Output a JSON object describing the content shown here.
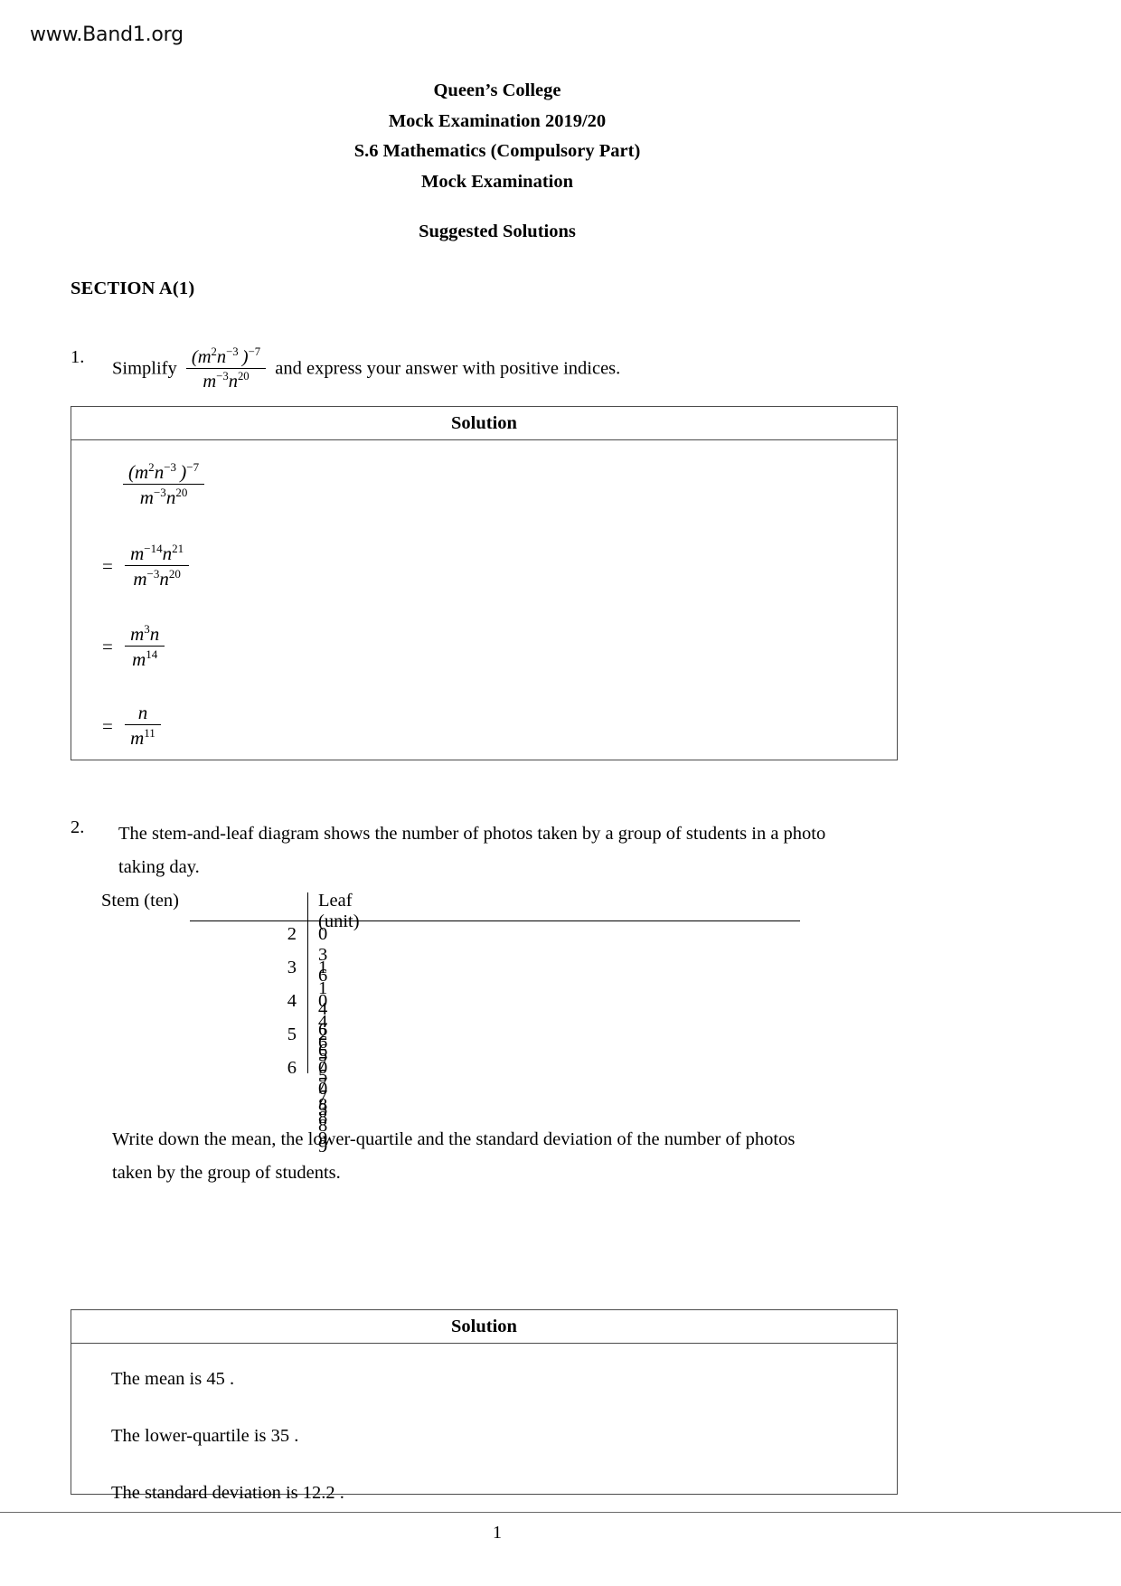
{
  "watermark": "www.Band1.org",
  "header": {
    "line1": "Queen’s College",
    "line2": "Mock Examination 2019/20",
    "line3": "S.6 Mathematics (Compulsory Part)",
    "line4": "Mock Examination",
    "line5": "Suggested Solutions"
  },
  "section": {
    "heading": "SECTION A(1)"
  },
  "solution_label": "Solution",
  "questions": [
    {
      "number": "1.",
      "text_before": "Simplify",
      "text_after": "and express your answer with positive indices.",
      "expression": {
        "numerator_base": "(m",
        "numerator": "(m²n⁻³)⁻⁷",
        "denominator": "m⁻³n²⁰"
      },
      "solution_steps": [
        {
          "eq": "",
          "num": "(m²n⁻³)⁻⁷",
          "den": "m⁻³n²⁰"
        },
        {
          "eq": "=",
          "num": "m⁻¹⁴n²¹",
          "den": "m⁻³n²⁰"
        },
        {
          "eq": "=",
          "num": "m³n",
          "den": "m¹⁴"
        },
        {
          "eq": "=",
          "num": "n",
          "den": "m¹¹"
        }
      ]
    },
    {
      "number": "2.",
      "text_line1": "The stem-and-leaf diagram shows the number of photos taken by a group of students in a  photo",
      "text_line2": "taking day.",
      "prompt_line1": "Write down the mean, the lower-quartile and the standard deviation of the number of photos",
      "prompt_line2": "taken by the group of students.",
      "solution_lines": [
        "The mean is  45 .",
        "The lower-quartile is  35 .",
        "The standard deviation is  12.2 ."
      ]
    }
  ],
  "stem_and_leaf": {
    "stem_header": "Stem (ten)",
    "leaf_header": "Leaf (unit)",
    "rows": [
      {
        "stem": "2",
        "leaves": [
          "0",
          "3",
          "6"
        ]
      },
      {
        "stem": "3",
        "leaves": [
          "1",
          "1",
          "4",
          "6",
          "6"
        ]
      },
      {
        "stem": "4",
        "leaves": [
          "0",
          "4",
          "6",
          "7",
          "7",
          "8",
          "8",
          "9"
        ]
      },
      {
        "stem": "5",
        "leaves": [
          "2",
          "5",
          "5",
          "7",
          "8",
          "9"
        ]
      },
      {
        "stem": "6",
        "leaves": [
          "0",
          "0",
          "3"
        ]
      }
    ]
  },
  "footer": {
    "page_number": "1"
  }
}
